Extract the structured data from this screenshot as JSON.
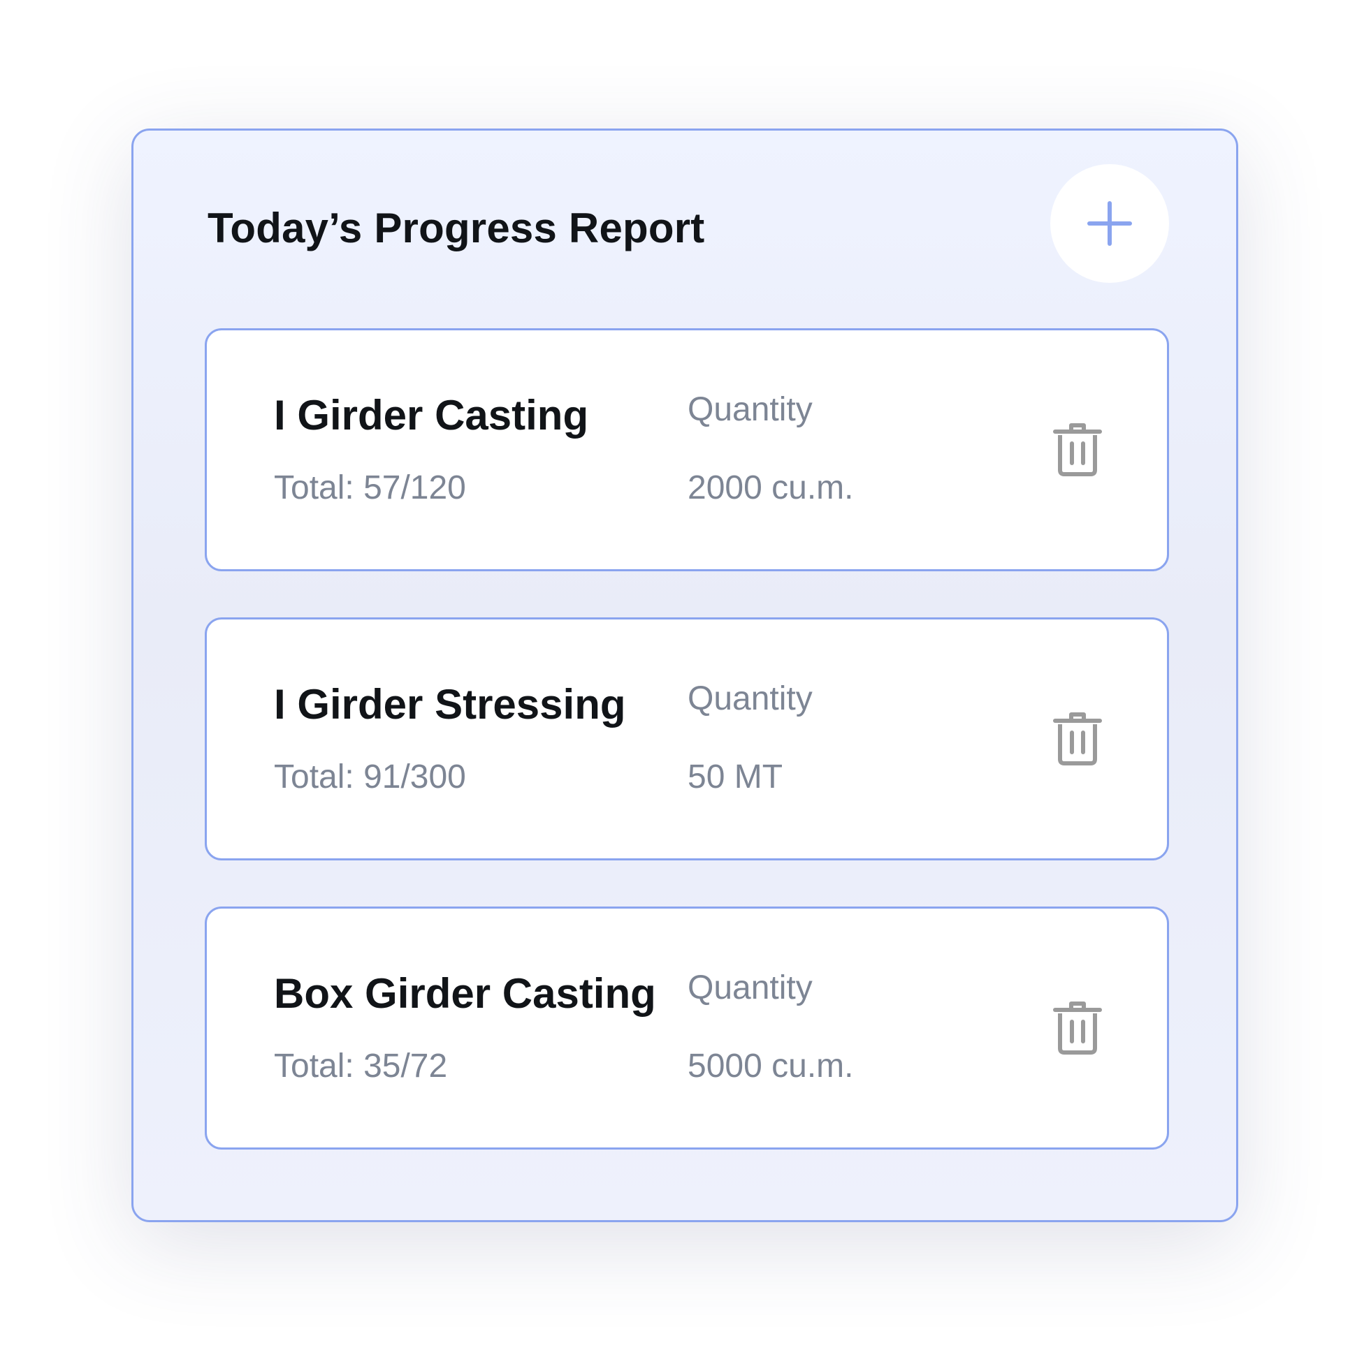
{
  "report": {
    "title": "Today’s Progress Report",
    "add_icon": "plus-icon"
  },
  "colors": {
    "accent": "#8aa4ef",
    "title_text": "#111418",
    "muted_text": "#7d8594",
    "icon_gray": "#9a9a9a"
  },
  "items": [
    {
      "name": "I Girder Casting",
      "total": "Total: 57/120",
      "quantity_label": "Quantity",
      "quantity_value": "2000 cu.m.",
      "delete_icon": "trash-icon"
    },
    {
      "name": "I Girder Stressing",
      "total": "Total: 91/300",
      "quantity_label": "Quantity",
      "quantity_value": "50 MT",
      "delete_icon": "trash-icon"
    },
    {
      "name": "Box Girder Casting",
      "total": "Total: 35/72",
      "quantity_label": "Quantity",
      "quantity_value": "5000 cu.m.",
      "delete_icon": "trash-icon"
    }
  ]
}
